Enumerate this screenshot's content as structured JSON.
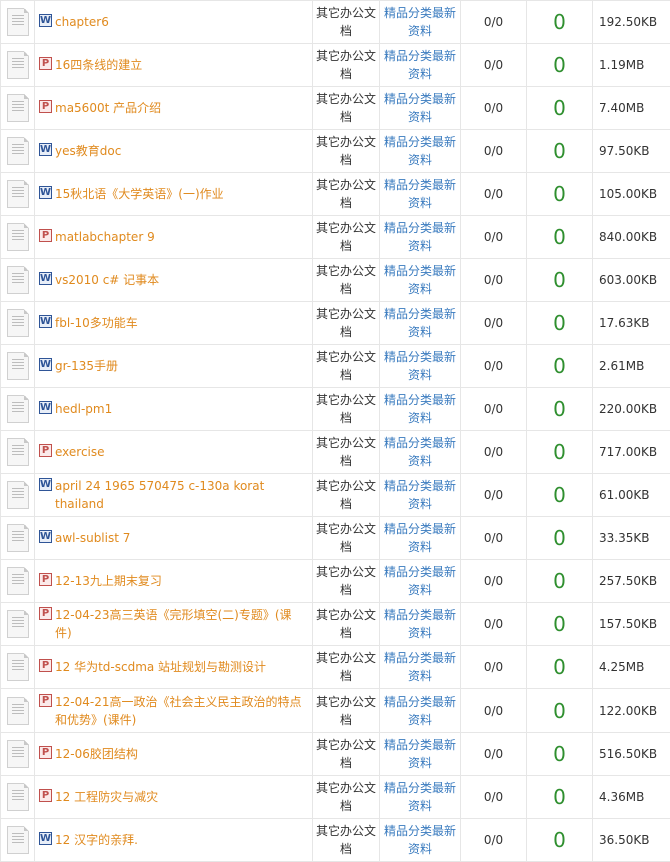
{
  "rows": [
    {
      "icon": "word",
      "title": "chapter6",
      "category": "其它办公文档",
      "subcategory": "精品分类最新资料",
      "ratio": "0/0",
      "count": "0",
      "size": "192.50KB"
    },
    {
      "icon": "ppt",
      "title": "16四条线的建立",
      "category": "其它办公文档",
      "subcategory": "精品分类最新资料",
      "ratio": "0/0",
      "count": "0",
      "size": "1.19MB"
    },
    {
      "icon": "ppt",
      "title": "ma5600t 产品介绍",
      "category": "其它办公文档",
      "subcategory": "精品分类最新资料",
      "ratio": "0/0",
      "count": "0",
      "size": "7.40MB"
    },
    {
      "icon": "word",
      "title": "yes教育doc",
      "category": "其它办公文档",
      "subcategory": "精品分类最新资料",
      "ratio": "0/0",
      "count": "0",
      "size": "97.50KB"
    },
    {
      "icon": "word",
      "title": "15秋北语《大学英语》(一)作业",
      "category": "其它办公文档",
      "subcategory": "精品分类最新资料",
      "ratio": "0/0",
      "count": "0",
      "size": "105.00KB"
    },
    {
      "icon": "ppt",
      "title": "matlabchapter 9",
      "category": "其它办公文档",
      "subcategory": "精品分类最新资料",
      "ratio": "0/0",
      "count": "0",
      "size": "840.00KB"
    },
    {
      "icon": "word",
      "title": "vs2010 c# 记事本",
      "category": "其它办公文档",
      "subcategory": "精品分类最新资料",
      "ratio": "0/0",
      "count": "0",
      "size": "603.00KB"
    },
    {
      "icon": "word",
      "title": "fbl-10多功能车",
      "category": "其它办公文档",
      "subcategory": "精品分类最新资料",
      "ratio": "0/0",
      "count": "0",
      "size": "17.63KB"
    },
    {
      "icon": "word",
      "title": "gr-135手册",
      "category": "其它办公文档",
      "subcategory": "精品分类最新资料",
      "ratio": "0/0",
      "count": "0",
      "size": "2.61MB"
    },
    {
      "icon": "word",
      "title": "hedl-pm1",
      "category": "其它办公文档",
      "subcategory": "精品分类最新资料",
      "ratio": "0/0",
      "count": "0",
      "size": "220.00KB"
    },
    {
      "icon": "ppt",
      "title": "exercise",
      "category": "其它办公文档",
      "subcategory": "精品分类最新资料",
      "ratio": "0/0",
      "count": "0",
      "size": "717.00KB"
    },
    {
      "icon": "word",
      "title": "april 24 1965 570475 c-130a korat thailand",
      "category": "其它办公文档",
      "subcategory": "精品分类最新资料",
      "ratio": "0/0",
      "count": "0",
      "size": "61.00KB"
    },
    {
      "icon": "word",
      "title": "awl-sublist 7",
      "category": "其它办公文档",
      "subcategory": "精品分类最新资料",
      "ratio": "0/0",
      "count": "0",
      "size": "33.35KB"
    },
    {
      "icon": "ppt",
      "title": "12-13九上期末复习",
      "category": "其它办公文档",
      "subcategory": "精品分类最新资料",
      "ratio": "0/0",
      "count": "0",
      "size": "257.50KB"
    },
    {
      "icon": "ppt",
      "title": "12-04-23高三英语《完形填空(二)专题》(课件)",
      "category": "其它办公文档",
      "subcategory": "精品分类最新资料",
      "ratio": "0/0",
      "count": "0",
      "size": "157.50KB"
    },
    {
      "icon": "ppt",
      "title": "12 华为td-scdma 站址规划与勘测设计",
      "category": "其它办公文档",
      "subcategory": "精品分类最新资料",
      "ratio": "0/0",
      "count": "0",
      "size": "4.25MB"
    },
    {
      "icon": "ppt",
      "title": "12-04-21高一政治《社会主义民主政治的特点和优势》(课件)",
      "category": "其它办公文档",
      "subcategory": "精品分类最新资料",
      "ratio": "0/0",
      "count": "0",
      "size": "122.00KB"
    },
    {
      "icon": "ppt",
      "title": "12-06胶团结构",
      "category": "其它办公文档",
      "subcategory": "精品分类最新资料",
      "ratio": "0/0",
      "count": "0",
      "size": "516.50KB"
    },
    {
      "icon": "ppt",
      "title": "12 工程防灾与减灾",
      "category": "其它办公文档",
      "subcategory": "精品分类最新资料",
      "ratio": "0/0",
      "count": "0",
      "size": "4.36MB"
    },
    {
      "icon": "word",
      "title": "12 汉字的亲拜.",
      "category": "其它办公文档",
      "subcategory": "精品分类最新资料",
      "ratio": "0/0",
      "count": "0",
      "size": "36.50KB"
    }
  ],
  "icon_letters": {
    "word": "W",
    "ppt": "P"
  },
  "colors": {
    "title_link": "#e08a1e",
    "subcategory_link": "#3a7bbf",
    "count": "#2f8f2f",
    "word_icon": "#2f5597",
    "ppt_icon": "#c0504d"
  }
}
